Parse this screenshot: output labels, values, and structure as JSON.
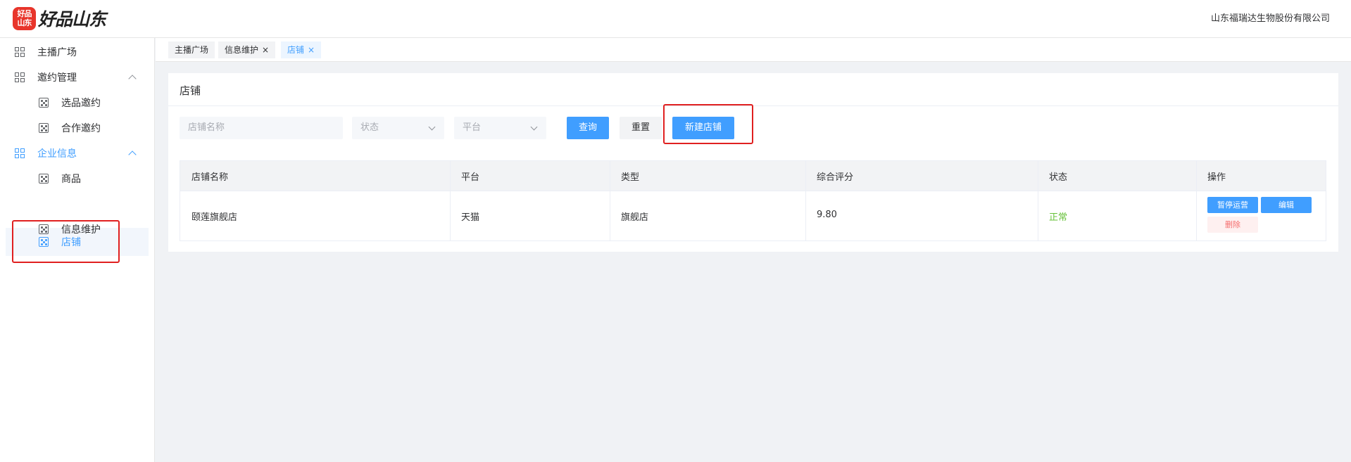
{
  "header": {
    "logo_badge_line1": "好品",
    "logo_badge_line2": "山东",
    "logo_text": "好品山东",
    "company": "山东福瑞达生物股份有限公司"
  },
  "sidebar": {
    "items": [
      {
        "label": "主播广场",
        "icon": "grid-icon"
      },
      {
        "label": "邀约管理",
        "icon": "grid-icon",
        "expanded": true
      },
      {
        "label": "选品邀约",
        "icon": "dice-icon"
      },
      {
        "label": "合作邀约",
        "icon": "dice-icon"
      },
      {
        "label": "企业信息",
        "icon": "grid-icon",
        "expanded": true
      },
      {
        "label": "商品",
        "icon": "dice-icon"
      },
      {
        "label": "店铺",
        "icon": "dice-icon",
        "selected": true
      },
      {
        "label": "信息维护",
        "icon": "dice-icon"
      }
    ]
  },
  "tabs": [
    {
      "label": "主播广场"
    },
    {
      "label": "信息维护",
      "close": "×"
    },
    {
      "label": "店铺",
      "close": "×",
      "active": true
    }
  ],
  "main": {
    "title": "店铺",
    "filters": {
      "shop_name_placeholder": "店铺名称",
      "status_placeholder": "状态",
      "platform_placeholder": "平台"
    },
    "buttons": {
      "search": "查询",
      "reset": "重置",
      "create": "新建店铺"
    },
    "table": {
      "columns": [
        "店铺名称",
        "平台",
        "类型",
        "综合评分",
        "状态",
        "操作"
      ],
      "rows": [
        {
          "name": "颐莲旗舰店",
          "platform": "天猫",
          "type": "旗舰店",
          "score": "9.80",
          "status": "正常",
          "actions": {
            "pause": "暂停运营",
            "edit": "编辑",
            "delete": "删除"
          }
        }
      ]
    }
  },
  "colors": {
    "primary": "#409eff",
    "success": "#67c23a",
    "danger": "#f56c6c",
    "highlight": "#e02020"
  }
}
